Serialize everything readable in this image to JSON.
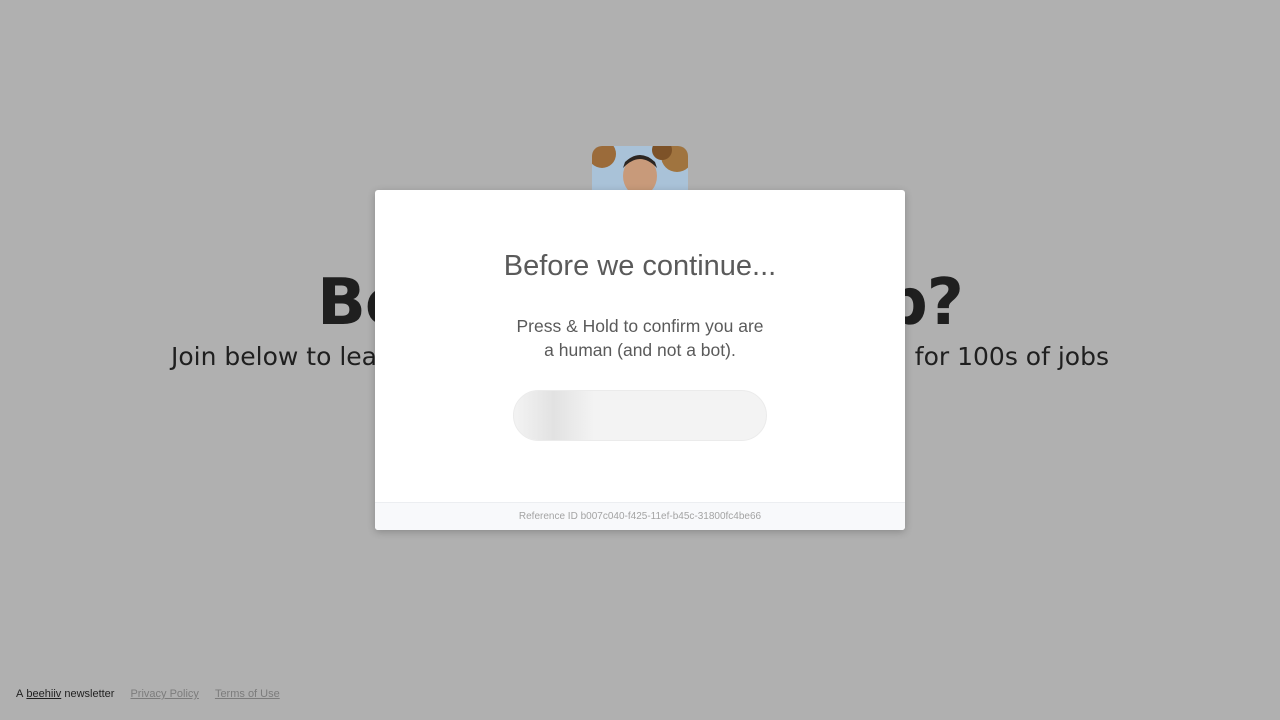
{
  "background": {
    "hero_title": "Bored of your job?",
    "hero_subtitle": "Join below to learn about the remote tech jobs we're hiring for 100s of jobs"
  },
  "footer": {
    "prefix": "A",
    "brand": "beehiiv",
    "suffix": "newsletter",
    "privacy_link": "Privacy Policy",
    "terms_link": "Terms of Use"
  },
  "modal": {
    "title": "Before we continue...",
    "text_line1": "Press & Hold to confirm you are",
    "text_line2": "a human (and not a bot).",
    "reference_label": "Reference ID",
    "reference_id": "b007c040-f425-11ef-b45c-31800fc4be66"
  },
  "colors": {
    "overlay": "#b0b0b0",
    "modal_bg": "#ffffff",
    "modal_text": "#5a5a5a",
    "hold_button_bg": "#f3f3f3"
  }
}
